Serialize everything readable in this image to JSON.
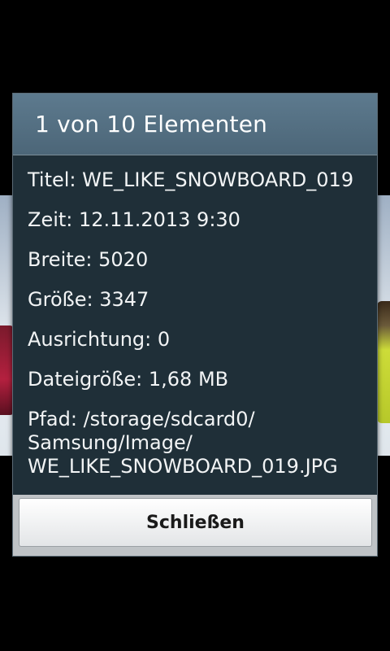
{
  "dialog": {
    "title": "1 von 10 Elementen",
    "details": {
      "title": "Titel: WE_LIKE_SNOWBOARD_019",
      "time": "Zeit: 12.11.2013 9:30",
      "width": "Breite: 5020",
      "size": "Größe: 3347",
      "orientation": "Ausrichtung: 0",
      "filesize": "Dateigröße: 1,68 MB",
      "path_line1": "Pfad: /storage/sdcard0/",
      "path_line2": "Samsung/Image/",
      "path_line3": "WE_LIKE_SNOWBOARD_019.JPG"
    },
    "close_label": "Schließen"
  },
  "colors": {
    "header": "#55707f",
    "body": "#1f2f38",
    "text": "#f2f4f5",
    "footer": "#bfc3c6"
  }
}
